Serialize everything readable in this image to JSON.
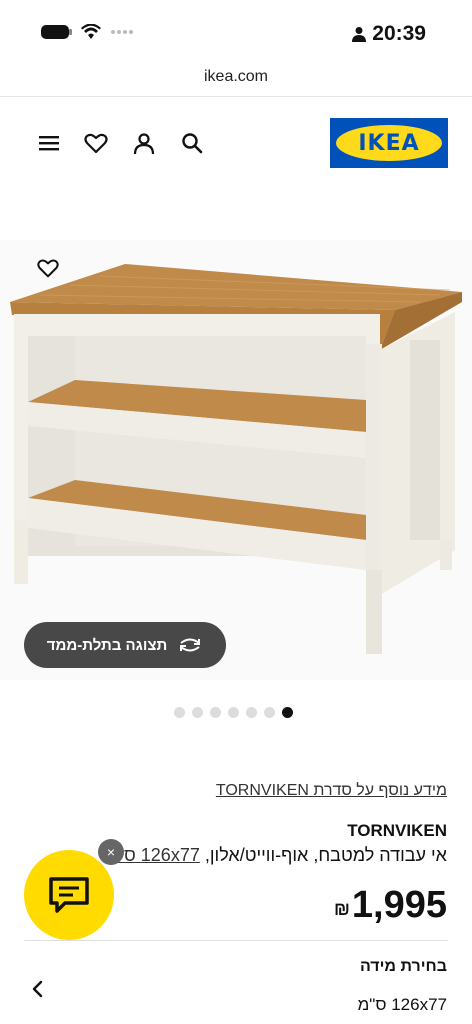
{
  "status_bar": {
    "time": "20:39"
  },
  "browser": {
    "url": "ikea.com"
  },
  "header": {
    "logo_text": "IKEA"
  },
  "gallery": {
    "view_3d_label": "תצוגה בתלת-ממד",
    "dots_total": 7,
    "active_dot": 7
  },
  "product": {
    "series_link": "מידע נוסף על סדרת TORNVIKEN",
    "name": "TORNVIKEN",
    "description": "אי עבודה למטבח, אוף-ווייט/אלון,",
    "size_link": "126x77 ס\"מ",
    "price": "1,995",
    "currency": "₪"
  },
  "size_selection": {
    "title": "בחירת מידה",
    "value": "126x77 ס\"מ"
  },
  "chat": {
    "close_label": "×"
  },
  "colors": {
    "brand_blue": "#0051ba",
    "brand_yellow": "#ffda1a",
    "chat_yellow": "#ffdb00"
  }
}
